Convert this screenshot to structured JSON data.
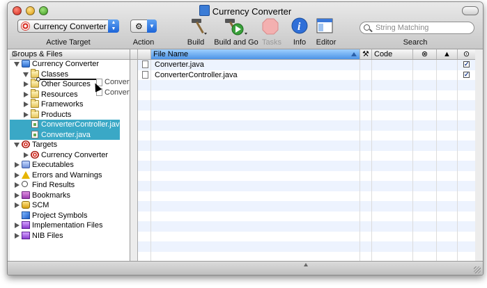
{
  "window": {
    "title": "Currency Converter"
  },
  "toolbar": {
    "active_target_value": "Currency Converter",
    "active_target_label": "Active Target",
    "action_label": "Action",
    "build_label": "Build",
    "build_go_label": "Build and Go",
    "tasks_label": "Tasks",
    "info_label": "Info",
    "editor_label": "Editor",
    "search_placeholder": "String Matching",
    "search_label": "Search"
  },
  "sidebar": {
    "header": "Groups & Files",
    "items": [
      {
        "label": "Currency Converter"
      },
      {
        "label": "Classes"
      },
      {
        "label": "Other Sources"
      },
      {
        "label": "Resources"
      },
      {
        "label": "Frameworks"
      },
      {
        "label": "Products"
      },
      {
        "label": "ConverterController.java"
      },
      {
        "label": "Converter.java"
      },
      {
        "label": "Targets"
      },
      {
        "label": "Currency Converter"
      },
      {
        "label": "Executables"
      },
      {
        "label": "Errors and Warnings"
      },
      {
        "label": "Find Results"
      },
      {
        "label": "Bookmarks"
      },
      {
        "label": "SCM"
      },
      {
        "label": "Project Symbols"
      },
      {
        "label": "Implementation Files"
      },
      {
        "label": "NIB Files"
      }
    ]
  },
  "drag": {
    "item1": "ConverterController.java",
    "item2": "Converter.java"
  },
  "filelist": {
    "columns": {
      "file_name": "File Name",
      "code": "Code"
    },
    "rows": [
      {
        "name": "Converter.java"
      },
      {
        "name": "ConverterController.java"
      }
    ]
  },
  "colors": {
    "selection": "#3aa8c6",
    "accent": "#1c64d8"
  }
}
